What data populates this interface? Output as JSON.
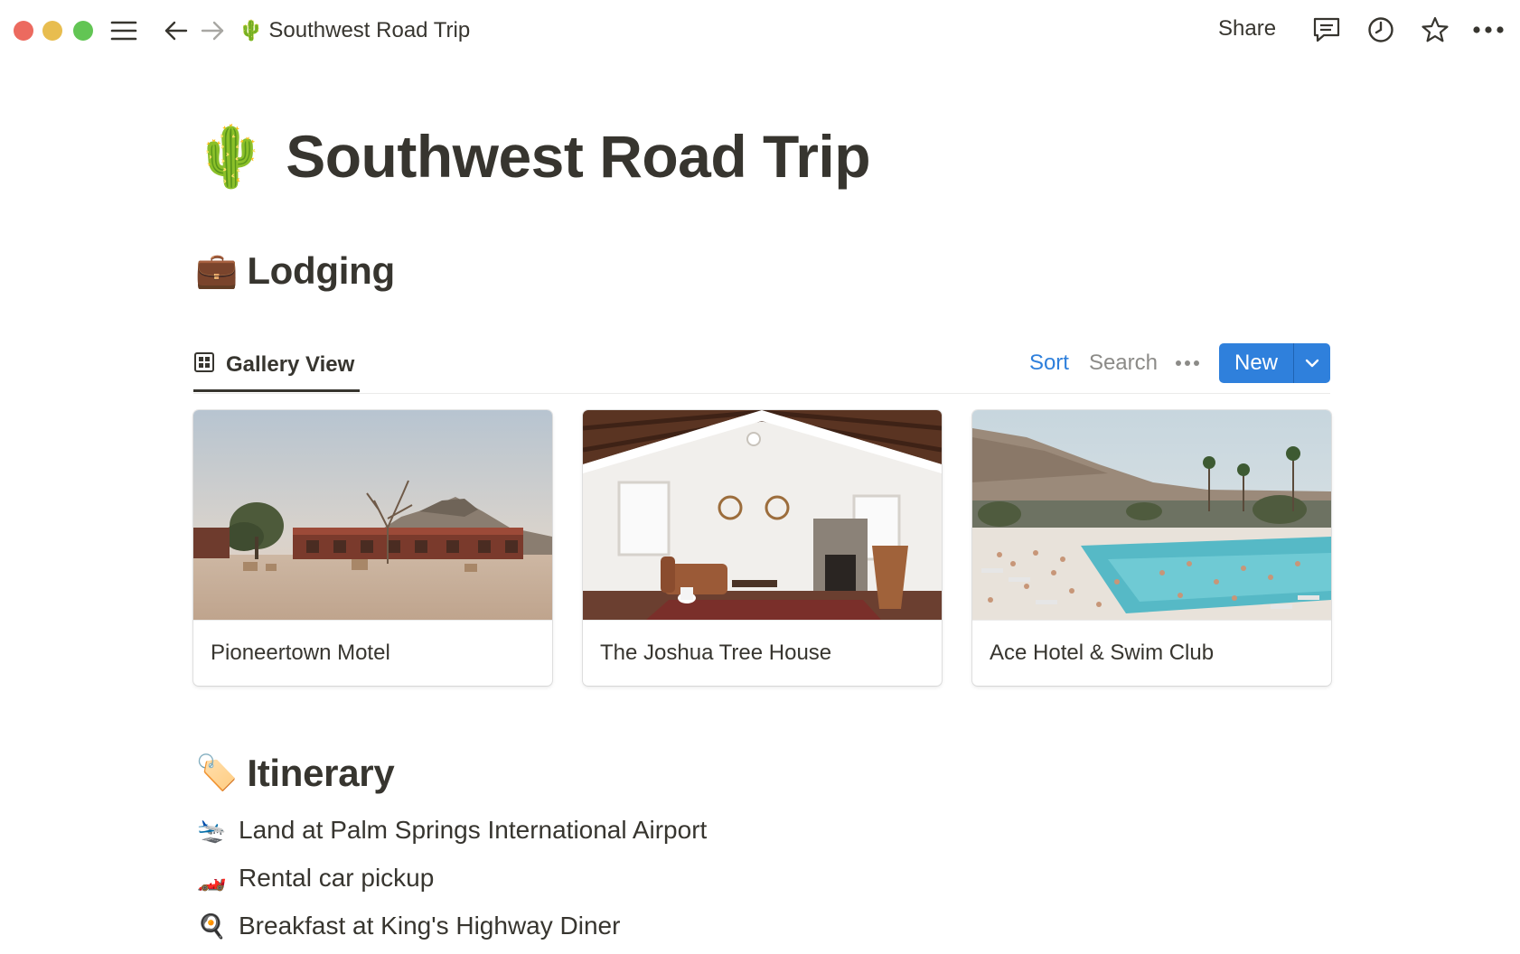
{
  "window": {
    "traffic_lights": {
      "close": "#ec6a5f",
      "minimize": "#e8bd4f",
      "zoom": "#62c554"
    }
  },
  "topbar": {
    "breadcrumb_emoji": "🌵",
    "breadcrumb_title": "Southwest Road Trip",
    "share_label": "Share",
    "icons": [
      "menu-icon",
      "back-arrow-icon",
      "forward-arrow-icon",
      "comment-icon",
      "clock-icon",
      "star-icon",
      "more-icon"
    ]
  },
  "page": {
    "emoji": "🌵",
    "title": "Southwest Road Trip"
  },
  "lodging": {
    "emoji": "💼",
    "heading": "Lodging",
    "view": {
      "icon": "gallery-grid-icon",
      "label": "Gallery View",
      "sort_label": "Sort",
      "search_label": "Search",
      "new_label": "New",
      "accent_color": "#2f80dc"
    },
    "cards": [
      {
        "name": "Pioneertown Motel",
        "cover": "desert-motel-photo"
      },
      {
        "name": "The Joshua Tree House",
        "cover": "interior-living-room-photo"
      },
      {
        "name": "Ace Hotel & Swim Club",
        "cover": "pool-party-photo"
      }
    ]
  },
  "itinerary": {
    "emoji": "🏷️",
    "heading": "Itinerary",
    "items": [
      {
        "emoji": "🛬",
        "text": "Land at Palm Springs International Airport"
      },
      {
        "emoji": "🏎️",
        "text": "Rental car pickup"
      },
      {
        "emoji": "🍳",
        "text": "Breakfast at King's Highway Diner"
      }
    ]
  }
}
